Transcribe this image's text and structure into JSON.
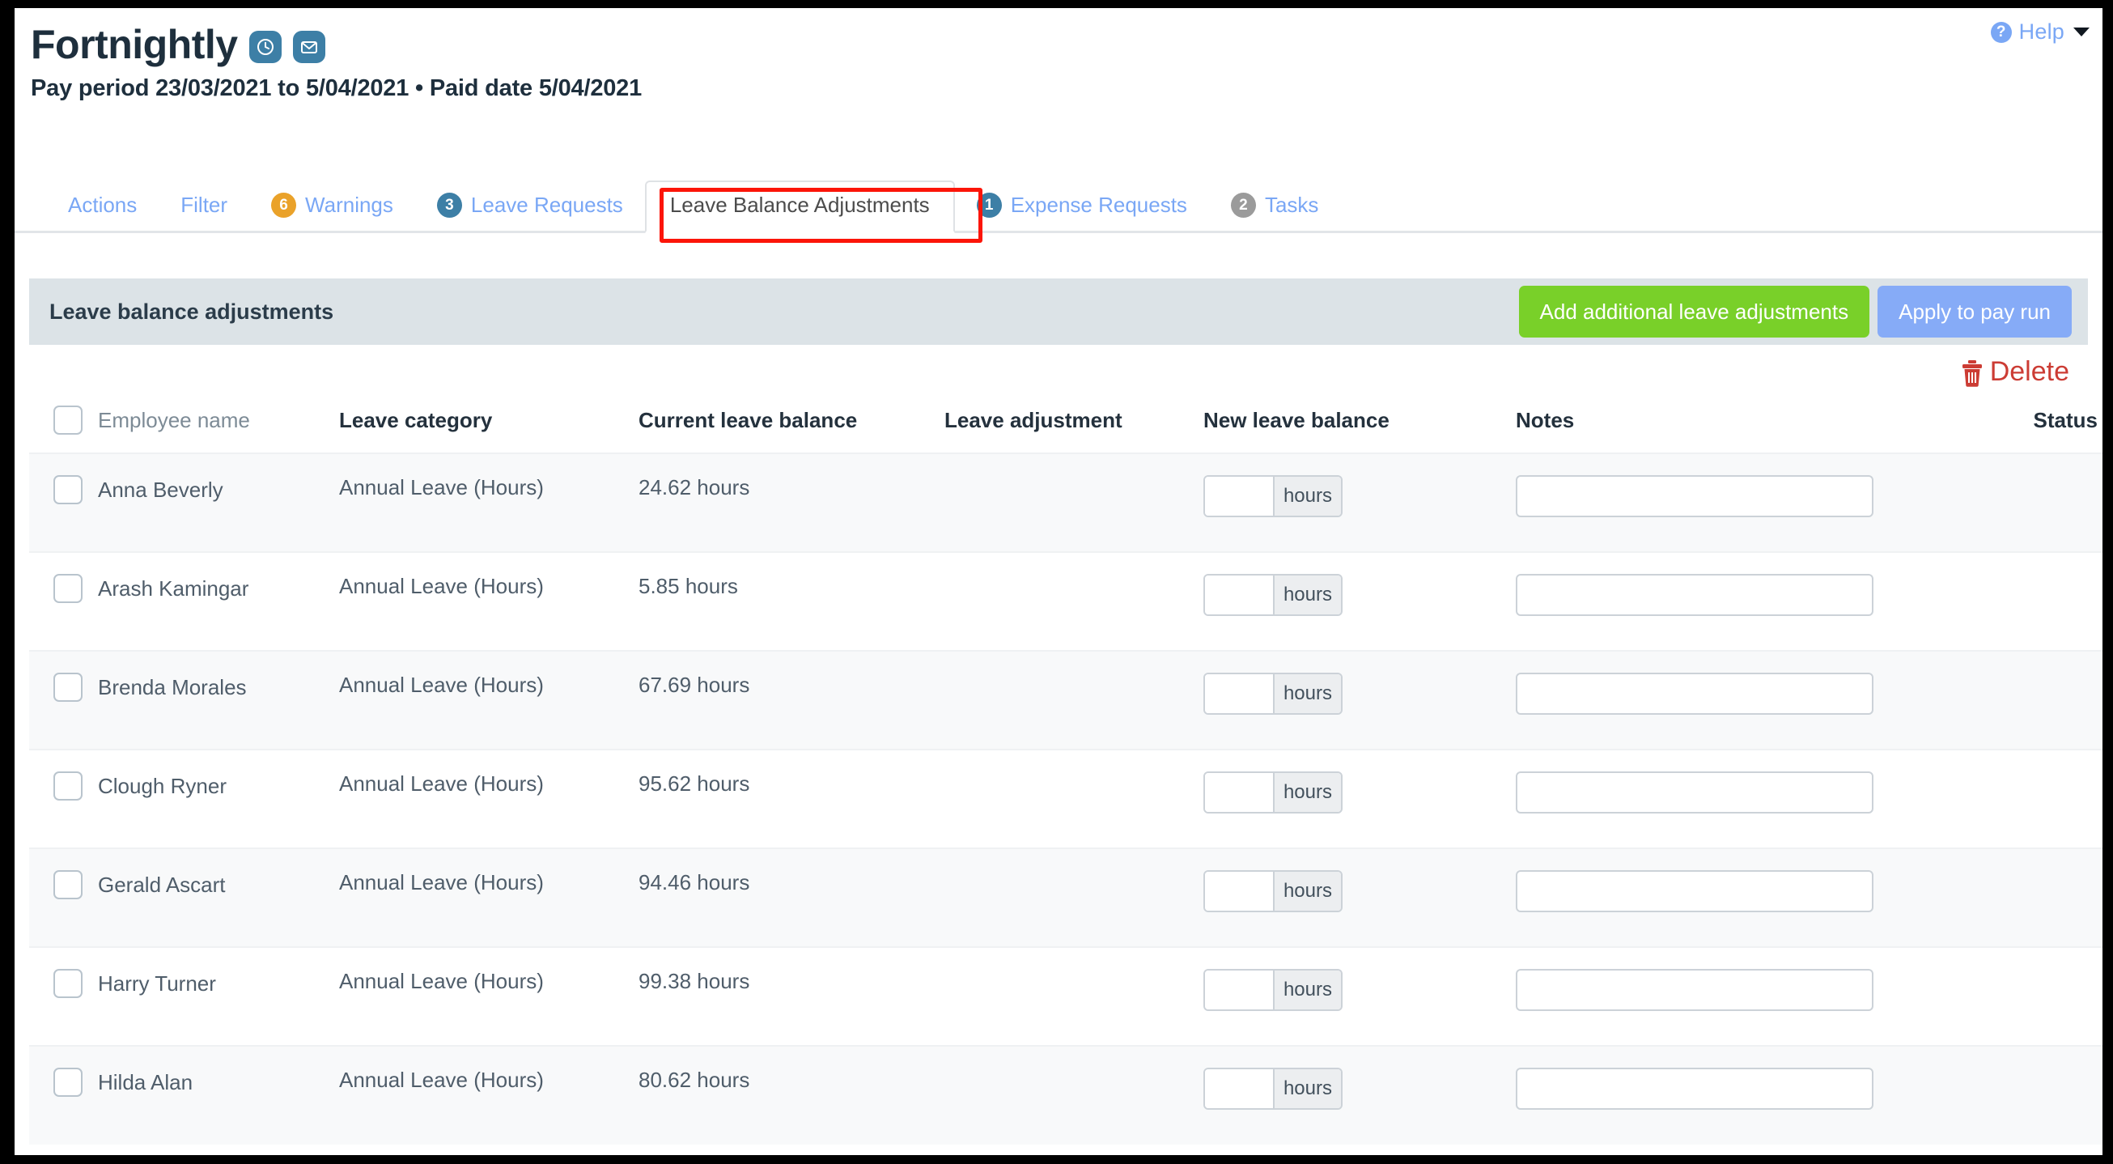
{
  "help": {
    "label": "Help",
    "icon": "question-circle-icon",
    "caret": "chevron-down-icon"
  },
  "header": {
    "title": "Fortnightly",
    "subtitle": "Pay period 23/03/2021 to 5/04/2021 • Paid date 5/04/2021",
    "icons": [
      "clock-icon",
      "envelope-icon"
    ],
    "icon_color": "#3d7fa6"
  },
  "tabs": [
    {
      "label": "Actions",
      "count": null,
      "count_color": null,
      "active": false
    },
    {
      "label": "Filter",
      "count": null,
      "count_color": null,
      "active": false
    },
    {
      "label": "Warnings",
      "count": "6",
      "count_color": "#eaa22a",
      "active": false
    },
    {
      "label": "Leave Requests",
      "count": "3",
      "count_color": "#3d7fa6",
      "active": false
    },
    {
      "label": "Leave Balance Adjustments",
      "count": null,
      "count_color": null,
      "active": true
    },
    {
      "label": "Expense Requests",
      "count": "1",
      "count_color": "#3d7fa6",
      "active": false
    },
    {
      "label": "Tasks",
      "count": "2",
      "count_color": "#9b9b9b",
      "active": false
    }
  ],
  "annotation": {
    "color": "#fc1509",
    "target": "Leave Balance Adjustments"
  },
  "panel": {
    "title": "Leave balance adjustments",
    "add_button": "Add additional leave adjustments",
    "add_button_color": "#79d029",
    "apply_button": "Apply to pay run",
    "apply_button_color": "#86abf7",
    "delete_label": "Delete",
    "delete_color": "#cc3c34",
    "delete_icon": "trash-icon"
  },
  "table": {
    "columns": [
      "Employee name",
      "Leave category",
      "Current leave balance",
      "Leave adjustment",
      "New leave balance",
      "Notes",
      "Status"
    ],
    "hours_addon": "hours",
    "rows": [
      {
        "name": "Anna Beverly",
        "category": "Annual Leave (Hours)",
        "current_balance": "24.62 hours",
        "adjustment": "",
        "new_balance": "",
        "notes": "",
        "status": ""
      },
      {
        "name": "Arash Kamingar",
        "category": "Annual Leave (Hours)",
        "current_balance": "5.85 hours",
        "adjustment": "",
        "new_balance": "",
        "notes": "",
        "status": ""
      },
      {
        "name": "Brenda Morales",
        "category": "Annual Leave (Hours)",
        "current_balance": "67.69 hours",
        "adjustment": "",
        "new_balance": "",
        "notes": "",
        "status": ""
      },
      {
        "name": "Clough Ryner",
        "category": "Annual Leave (Hours)",
        "current_balance": "95.62 hours",
        "adjustment": "",
        "new_balance": "",
        "notes": "",
        "status": ""
      },
      {
        "name": "Gerald Ascart",
        "category": "Annual Leave (Hours)",
        "current_balance": "94.46 hours",
        "adjustment": "",
        "new_balance": "",
        "notes": "",
        "status": ""
      },
      {
        "name": "Harry Turner",
        "category": "Annual Leave (Hours)",
        "current_balance": "99.38 hours",
        "adjustment": "",
        "new_balance": "",
        "notes": "",
        "status": ""
      },
      {
        "name": "Hilda Alan",
        "category": "Annual Leave (Hours)",
        "current_balance": "80.62 hours",
        "adjustment": "",
        "new_balance": "",
        "notes": "",
        "status": ""
      }
    ]
  }
}
